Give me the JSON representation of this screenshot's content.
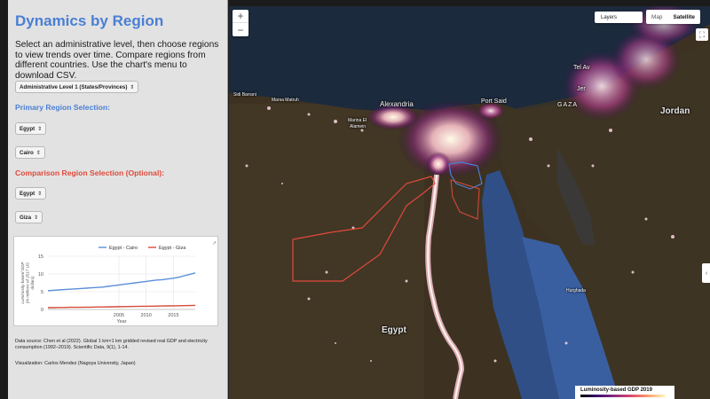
{
  "panel": {
    "title": "Dynamics by Region",
    "description": "Select an administrative level, then choose regions to view trends over time. Compare regions from different countries. Use the chart's menu to download CSV.",
    "admin_level": "Administrative Level 1 (States/Provinces)",
    "primary_heading": "Primary Region Selection:",
    "primary_country": "Egypt",
    "primary_region": "Cairo",
    "comparison_heading": "Comparison Region Selection (Optional):",
    "comparison_country": "Egypt",
    "comparison_region": "Giza",
    "data_source": "Data source: Chen et al (2022). Global 1 km×1 km gridded revised real GDP and electricity consumption (1992–2019). Scientific Data, 9(1), 1-14.",
    "visualization": "Visualization: Carlos Mendez (Nagoya University, Japan)",
    "colors": {
      "title": "#4a7fd4",
      "primary": "#4a7fd4",
      "comparison": "#e04a3a"
    }
  },
  "chart_data": {
    "type": "line",
    "x": [
      1992,
      1993,
      1994,
      1995,
      1996,
      1997,
      1998,
      1999,
      2000,
      2001,
      2002,
      2003,
      2004,
      2005,
      2006,
      2007,
      2008,
      2009,
      2010,
      2011,
      2012,
      2013,
      2014,
      2015,
      2016,
      2017,
      2018,
      2019
    ],
    "series": [
      {
        "name": "Egypt - Cairo",
        "color": "#5b8fd9",
        "values": [
          5.3,
          5.4,
          5.5,
          5.6,
          5.7,
          5.8,
          5.9,
          6.0,
          6.1,
          6.2,
          6.3,
          6.5,
          6.7,
          6.9,
          7.1,
          7.3,
          7.5,
          7.7,
          7.9,
          8.1,
          8.3,
          8.4,
          8.6,
          8.8,
          9.1,
          9.5,
          9.9,
          10.3
        ]
      },
      {
        "name": "Egypt - Giza",
        "color": "#d64a3a",
        "values": [
          0.5,
          0.5,
          0.55,
          0.55,
          0.6,
          0.6,
          0.6,
          0.65,
          0.65,
          0.7,
          0.7,
          0.72,
          0.75,
          0.78,
          0.8,
          0.82,
          0.85,
          0.88,
          0.9,
          0.92,
          0.95,
          0.98,
          1.0,
          1.02,
          1.05,
          1.08,
          1.12,
          1.15
        ]
      }
    ],
    "xlabel": "Year",
    "ylabel": "Luminosity-based GDP (in millions of 2017 US dollars)",
    "ylim": [
      0,
      15
    ],
    "xlim": [
      1992,
      2019
    ],
    "yticks": [
      0,
      5,
      10,
      15
    ],
    "xticks": [
      2005,
      2010,
      2015
    ],
    "grid": true,
    "legend": "top-right"
  },
  "map": {
    "zoom_in": "+",
    "zoom_out": "−",
    "layers": "Layers",
    "map_type": {
      "map": "Map",
      "satellite": "Satellite"
    },
    "labels": {
      "tel_aviv": "Tel Av",
      "jer": "Jer",
      "gaza": "GAZA",
      "jordan": "Jordan",
      "sidi_barrani": "Sidi Barrani",
      "mersa_matruh": "Marsa Matruh",
      "alexandria": "Alexandria",
      "port_said": "Port Said",
      "marina": "Marina El",
      "alamein": "Alamein",
      "egypt": "Egypt",
      "hurghada": "Hurghada"
    },
    "legend_title": "Luminosity-based GDP 2019"
  }
}
